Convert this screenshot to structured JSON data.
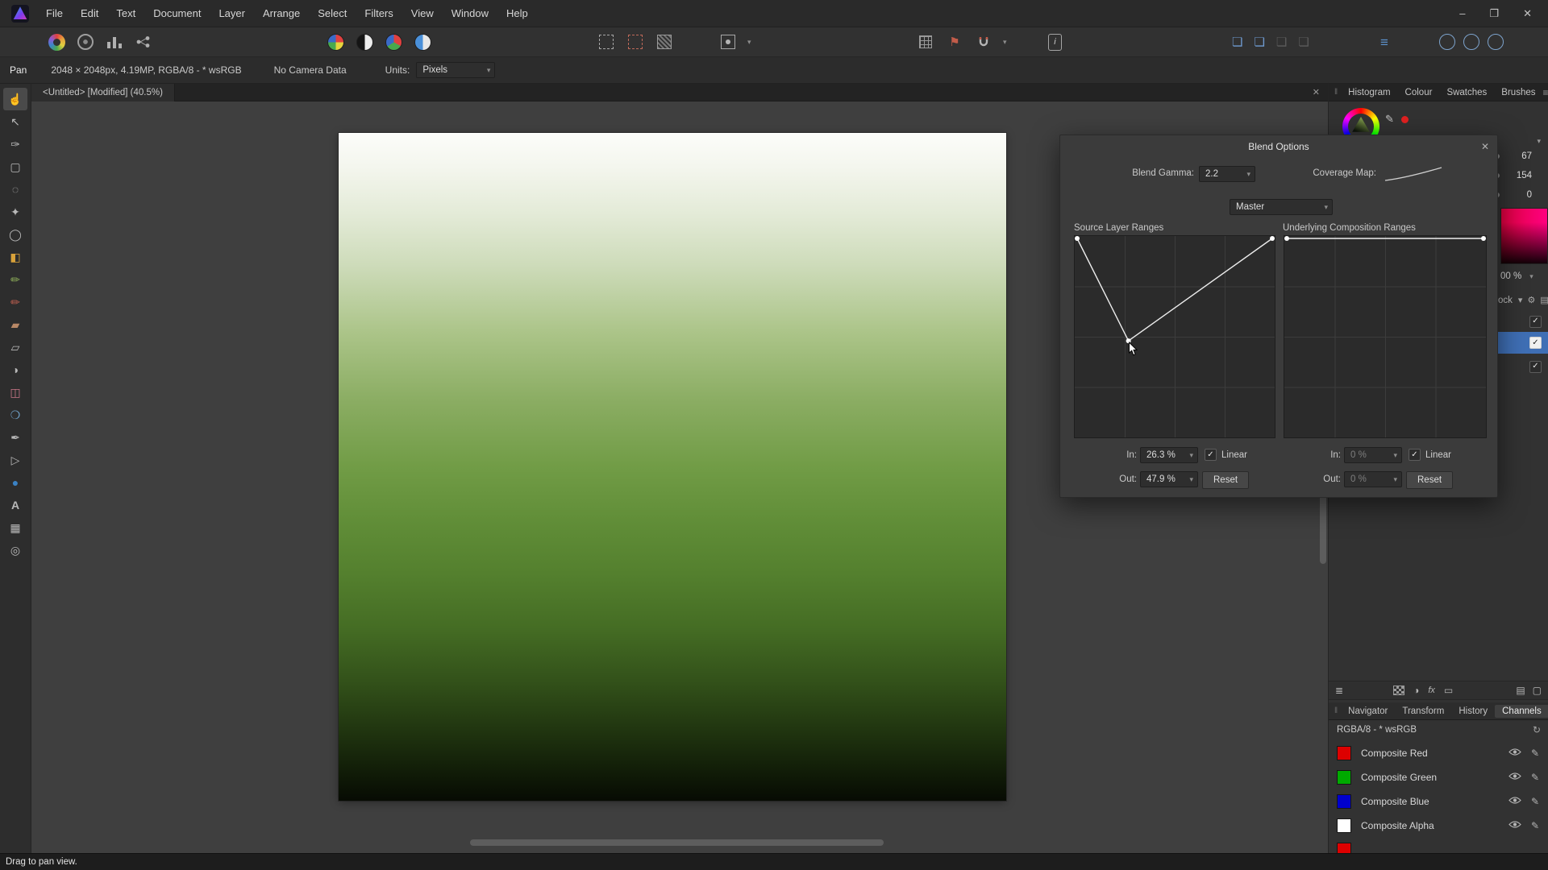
{
  "icons": {
    "close": "✕",
    "chevron": "▾",
    "check": "✓",
    "pencil": "✎",
    "refresh": "↻",
    "grip": "‖",
    "burger": "≡",
    "minimize": "–",
    "maximize": "❐",
    "gear": "⚙",
    "flag": "⚑",
    "info": "i",
    "stack": "❏",
    "lines": "≡",
    "layers": "≣",
    "half_circle": "◑",
    "mask": "▭",
    "folder": "▤",
    "newdoc": "▢",
    "fx": "fx"
  },
  "menubar": {
    "items": [
      "File",
      "Edit",
      "Text",
      "Document",
      "Layer",
      "Arrange",
      "Select",
      "Filters",
      "View",
      "Window",
      "Help"
    ]
  },
  "context_toolbar": {
    "tool": "Pan",
    "doc_info": "2048 × 2048px, 4.19MP, RGBA/8 - * wsRGB",
    "camera": "No Camera Data",
    "units_label": "Units:",
    "units_value": "Pixels"
  },
  "document_tab": {
    "title": "<Untitled> [Modified] (40.5%)"
  },
  "tools": [
    {
      "name": "view-tool",
      "glyph": "☝",
      "selected": true
    },
    {
      "name": "move-tool",
      "glyph": "↖"
    },
    {
      "name": "colour-picker-tool",
      "glyph": "✑"
    },
    {
      "name": "crop-tool",
      "glyph": "▢"
    },
    {
      "name": "selection-brush-tool",
      "glyph": "◌"
    },
    {
      "name": "flood-select-tool",
      "glyph": "✦"
    },
    {
      "name": "marquee-tool",
      "glyph": "◯"
    },
    {
      "name": "flood-fill-tool",
      "glyph": "◧",
      "color": "#d9a23a"
    },
    {
      "name": "paint-brush-tool",
      "glyph": "✏",
      "color": "#8fb05a"
    },
    {
      "name": "colour-replacement-brush-tool",
      "glyph": "✏",
      "color": "#c06050"
    },
    {
      "name": "pixel-tool",
      "glyph": "▰",
      "color": "#b88866"
    },
    {
      "name": "erase-brush-tool",
      "glyph": "▱"
    },
    {
      "name": "dodge-brush-tool",
      "glyph": "◑"
    },
    {
      "name": "clone-brush-tool",
      "glyph": "◫",
      "color": "#c97788"
    },
    {
      "name": "blur-tool",
      "glyph": "❍",
      "color": "#6fa0c8"
    },
    {
      "name": "sharpen-tool",
      "glyph": "✒"
    },
    {
      "name": "node-tool",
      "glyph": "▷"
    },
    {
      "name": "fill-tool",
      "glyph": "●",
      "color": "#3b82c4"
    },
    {
      "name": "text-tool",
      "glyph": "A"
    },
    {
      "name": "mesh-warp-tool",
      "glyph": "▦"
    },
    {
      "name": "zoom-tool",
      "glyph": "◎"
    }
  ],
  "blend_options": {
    "title": "Blend Options",
    "gamma_label": "Blend Gamma:",
    "gamma_value": "2.2",
    "coverage_label": "Coverage Map:",
    "channel_value": "Master",
    "source_title": "Source Layer Ranges",
    "underlying_title": "Underlying Composition Ranges",
    "source_points": [
      [
        0,
        100
      ],
      [
        26.3,
        47.9
      ],
      [
        100,
        100
      ]
    ],
    "underlying_points": [
      [
        0,
        100
      ],
      [
        100,
        100
      ]
    ],
    "in_label": "In:",
    "out_label": "Out:",
    "linear_label": "Linear",
    "reset_label": "Reset",
    "source_in": "26.3 %",
    "source_out": "47.9 %",
    "underlying_in": "0 %",
    "underlying_out": "0 %"
  },
  "right_panel": {
    "tabs": [
      "Histogram",
      "Colour",
      "Swatches",
      "Brushes"
    ],
    "color_values": [
      "67",
      "154",
      "0"
    ],
    "opacity_value": "00 %",
    "lock_label": "ock",
    "lower_tabs": [
      "Navigator",
      "Transform",
      "History",
      "Channels"
    ],
    "active_lower_tab": "Channels",
    "mode": "RGBA/8 - * wsRGB",
    "channels": [
      {
        "name": "Composite Red",
        "color": "#dd0000"
      },
      {
        "name": "Composite Green",
        "color": "#00aa00"
      },
      {
        "name": "Composite Blue",
        "color": "#0000cc"
      },
      {
        "name": "Composite Alpha",
        "color": "#ffffff"
      }
    ],
    "partial_channel_color": "#dd0000"
  },
  "status_bar": {
    "message": "Drag to pan view."
  },
  "canvas": {
    "gradient": [
      "#fcfdfa 0%",
      "#f4f6ee 5%",
      "#e4ebd8 12%",
      "#cddbb9 20%",
      "#abc488 30%",
      "#8bad63 40%",
      "#719c46 50%",
      "#618e38 58%",
      "#54802e 66%",
      "#456d24 74%",
      "#33521a 82%",
      "#1f330f 90%",
      "#101b07 96%",
      "#070b03 100%"
    ]
  }
}
